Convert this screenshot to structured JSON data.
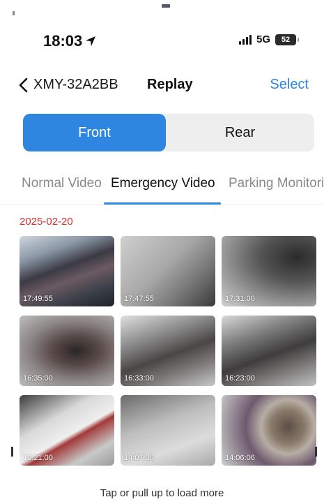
{
  "status_bar": {
    "time": "18:03",
    "network": "5G",
    "battery": "52"
  },
  "nav": {
    "device_name": "XMY-32A2BB",
    "title": "Replay",
    "select_label": "Select"
  },
  "segment": {
    "front_label": "Front",
    "rear_label": "Rear",
    "selected": "Front"
  },
  "tabs": [
    {
      "label": "Normal Video"
    },
    {
      "label": "Emergency Video"
    },
    {
      "label": "Parking Monitori"
    }
  ],
  "active_tab": "Emergency Video",
  "date": "2025-02-20",
  "videos": [
    {
      "time": "17:49:55"
    },
    {
      "time": "17:47:55"
    },
    {
      "time": "17:31:00"
    },
    {
      "time": "16:35:00"
    },
    {
      "time": "16:33:00"
    },
    {
      "time": "16:23:00"
    },
    {
      "time": "16:21:00"
    },
    {
      "time": "14:07:08"
    },
    {
      "time": "14:06:06"
    }
  ],
  "load_more": "Tap or pull up to load more",
  "colors": {
    "accent": "#2f86e1",
    "date_red": "#d7302c"
  }
}
